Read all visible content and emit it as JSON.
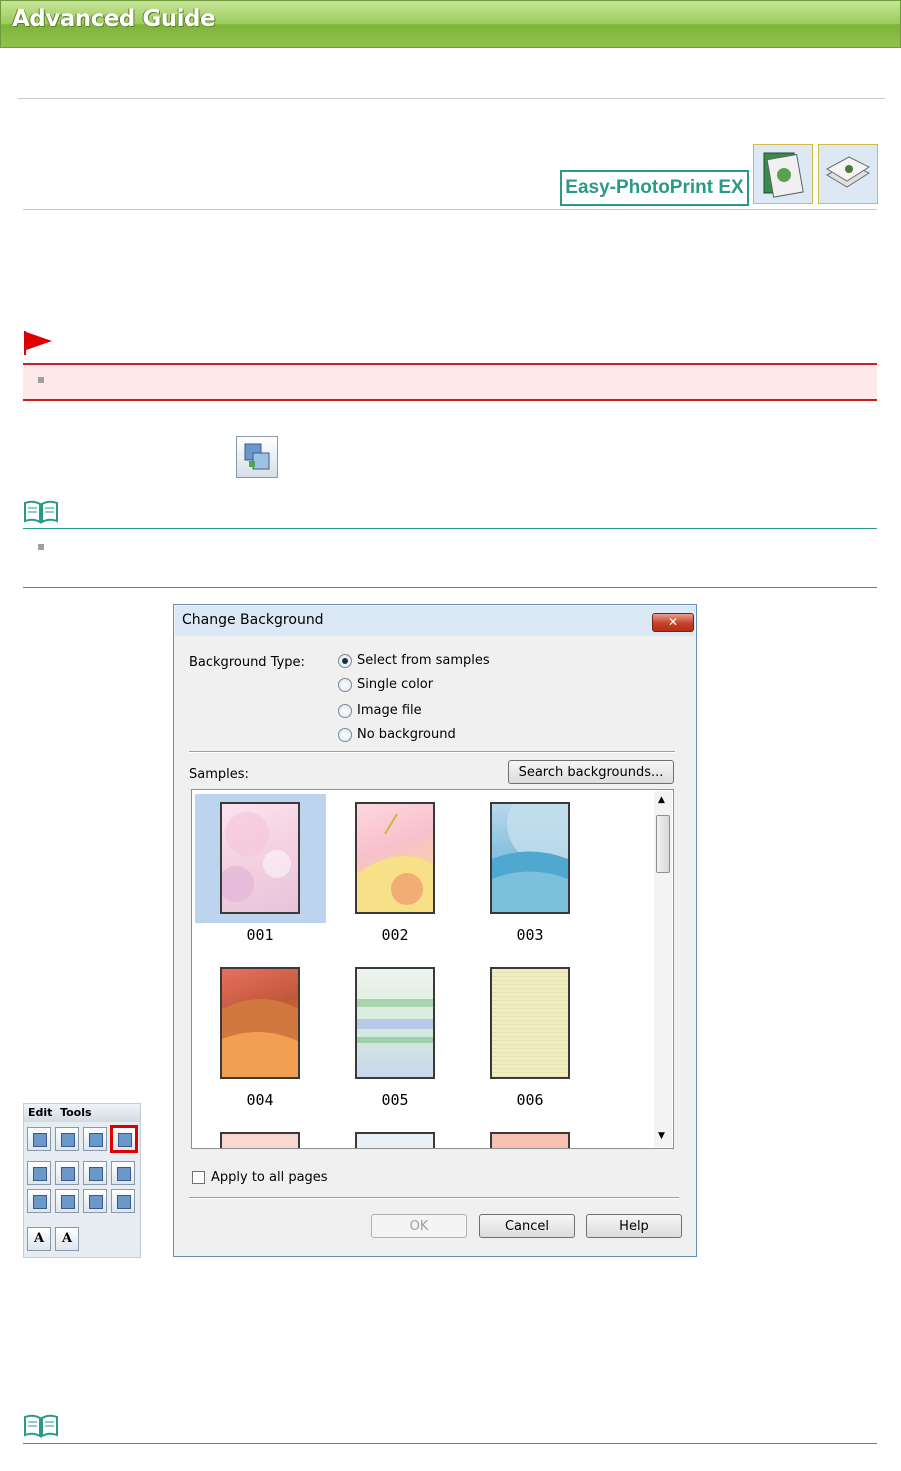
{
  "header": {
    "title": "Advanced Guide"
  },
  "badge": {
    "app_name": "Easy-PhotoPrint EX",
    "icons": [
      "album-icon",
      "stacked-photos-icon"
    ]
  },
  "toolbar_icon": "change-background-icon",
  "dialog": {
    "title": "Change Background",
    "close_label": "✕",
    "background_type_label": "Background Type:",
    "options": [
      "Select from samples",
      "Single color",
      "Image file",
      "No background"
    ],
    "selected_option": "Select from samples",
    "samples_label": "Samples:",
    "search_button": "Search backgrounds...",
    "samples": [
      "001",
      "002",
      "003",
      "004",
      "005",
      "006"
    ],
    "selected_sample": "001",
    "apply_all_label": "Apply to all pages",
    "ok_label": "OK",
    "cancel_label": "Cancel",
    "help_label": "Help"
  },
  "edit_tools": {
    "title": "Edit  Tools"
  },
  "colors": {
    "header_green": "#8fc24c",
    "caution_red": "#c82020",
    "note_teal": "#2a9a88",
    "selection_blue": "#bcd4ee"
  }
}
